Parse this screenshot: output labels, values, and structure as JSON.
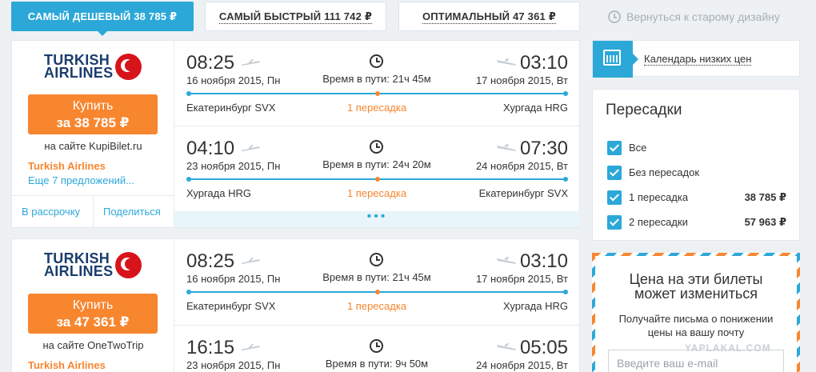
{
  "sort_tabs": [
    {
      "label": "САМЫЙ ДЕШЕВЫЙ 38 785 ₽",
      "active": true
    },
    {
      "label": "САМЫЙ БЫСТРЫЙ 111 742 ₽",
      "active": false
    },
    {
      "label": "ОПТИМАЛЬНЫЙ 47 361 ₽",
      "active": false
    }
  ],
  "back_link": "Вернуться к старому дизайну",
  "tickets": [
    {
      "airline_logo": {
        "line1": "TURKISH",
        "line2": "AIRLINES"
      },
      "buy_label": "Купить",
      "buy_price": "за 38 785 ₽",
      "site": "на сайте KupiBilet.ru",
      "airline": "Turkish Airlines",
      "more_offers": "Еще 7 предложений...",
      "installment": "В рассрочку",
      "share": "Поделиться",
      "more_dots": "•••",
      "flights": [
        {
          "dep_time": "08:25",
          "dep_date": "16 ноября 2015, Пн",
          "duration": "Время в пути: 21ч 45м",
          "arr_time": "03:10",
          "arr_date": "17 ноября 2015, Вт",
          "dep_city": "Екатеринбург SVX",
          "stops": "1 пересадка",
          "arr_city": "Хургада HRG"
        },
        {
          "dep_time": "04:10",
          "dep_date": "23 ноября 2015, Пн",
          "duration": "Время в пути: 24ч 20м",
          "arr_time": "07:30",
          "arr_date": "24 ноября 2015, Вт",
          "dep_city": "Хургада HRG",
          "stops": "1 пересадка",
          "arr_city": "Екатеринбург SVX"
        }
      ]
    },
    {
      "airline_logo": {
        "line1": "TURKISH",
        "line2": "AIRLINES"
      },
      "buy_label": "Купить",
      "buy_price": "за 47 361 ₽",
      "site": "на сайте OneTwoTrip",
      "airline": "Turkish Airlines",
      "flights": [
        {
          "dep_time": "08:25",
          "dep_date": "16 ноября 2015, Пн",
          "duration": "Время в пути: 21ч 45м",
          "arr_time": "03:10",
          "arr_date": "17 ноября 2015, Вт",
          "dep_city": "Екатеринбург SVX",
          "stops": "1 пересадка",
          "arr_city": "Хургада HRG"
        },
        {
          "dep_time": "16:15",
          "dep_date": "23 ноября 2015, Пн",
          "duration": "Время в пути: 9ч 50м",
          "arr_time": "05:05",
          "arr_date": "24 ноября 2015, Вт"
        }
      ]
    }
  ],
  "calendar_label": "Календарь низких цен",
  "filters": {
    "title": "Пересадки",
    "items": [
      {
        "label": "Все",
        "price": "",
        "checked": true
      },
      {
        "label": "Без пересадок",
        "price": "",
        "checked": true
      },
      {
        "label": "1 пересадка",
        "price": "38 785 ₽",
        "checked": true
      },
      {
        "label": "2 пересадки",
        "price": "57 963 ₽",
        "checked": true
      }
    ]
  },
  "price_alert": {
    "title_line1": "Цена на эти билеты",
    "title_line2": "может измениться",
    "text_line1": "Получайте письма о понижении",
    "text_line2": "цены на вашу почту",
    "email_placeholder": "Введите ваш e-mail"
  },
  "watermark": "YAPLAKAL.COM",
  "colors": {
    "accent_blue": "#2ca8d8",
    "accent_orange": "#f7862f",
    "brand_red": "#d7141a",
    "brand_navy": "#1b3d6d"
  }
}
